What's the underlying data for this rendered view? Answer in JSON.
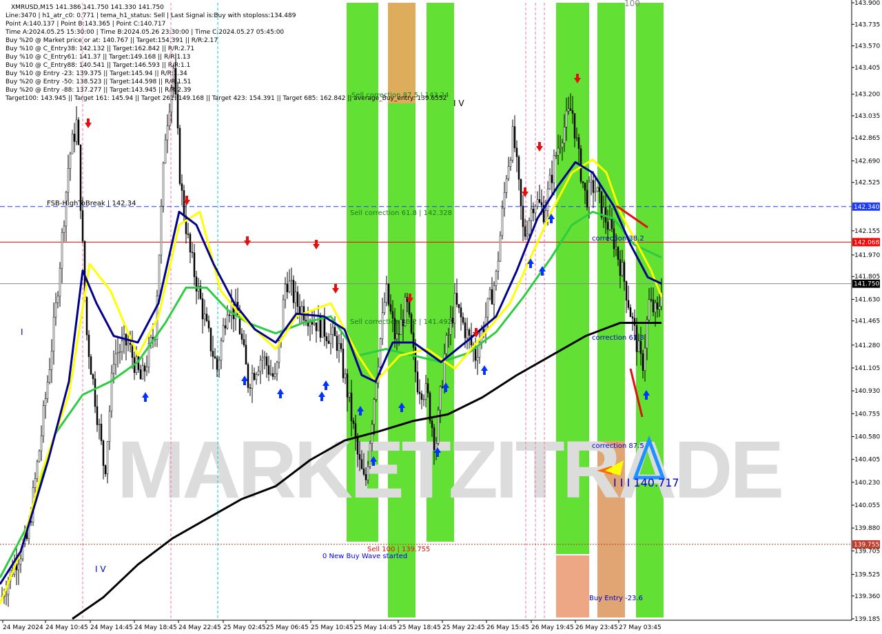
{
  "chart_data": {
    "type": "candlestick",
    "symbol": "XMRUSD,M15",
    "ohlc_header": "141.386 141.750 141.330 141.750",
    "info_lines": [
      "XMRUSD,M15  141.386 141.750 141.330 141.750",
      "Line:3470 | h1_atr_c0: 0.771 | tema_h1_status: Sell | Last Signal is:Buy with stoploss:134.489",
      "Point A:140.137 | Point B:143.365 | Point C:140.717",
      "Time A:2024.05.25 15:30:00 | Time B:2024.05.26 23:30:00 | Time C:2024.05.27 05:45:00",
      "Buy %20 @ Market price or at: 140.767 || Target:154.391 || R/R:2.17",
      "Buy %10 @ C_Entry38: 142.132 || Target:162.842 || R/R:2.71",
      "Buy %10 @ C_Entry61: 141.37 || Target:149.168 || R/R:1.13",
      "Buy %10 @ C_Entry88: 140.541 || Target:146.593 || R/R:1.1",
      "Buy %10 @ Entry -23: 139.375 || Target:145.94 || R/R:1.34",
      "Buy %20 @ Entry -50: 138.523 || Target:144.598 || R/R:1.51",
      "Buy %20 @ Entry -88: 137.277 || Target:143.945 || R/R:2.39",
      "Target100: 143.945 || Target 161: 145.94 || Target 261: 149.168 || Target 423: 154.391 || Target 685: 162.842 || average_Buy_entry: 139.6552"
    ],
    "y_range": [
      139.185,
      143.9
    ],
    "y_ticks": [
      "143.900",
      "143.735",
      "143.570",
      "143.405",
      "143.200",
      "143.035",
      "142.865",
      "142.690",
      "142.525",
      "142.340",
      "142.155",
      "141.970",
      "141.805",
      "141.630",
      "141.465",
      "141.280",
      "141.105",
      "140.930",
      "140.755",
      "140.580",
      "140.405",
      "140.230",
      "140.055",
      "139.880",
      "139.705",
      "139.525",
      "139.360",
      "139.185"
    ],
    "x_ticks": [
      "24 May 2024",
      "24 May 10:45",
      "24 May 14:45",
      "24 May 18:45",
      "24 May 22:45",
      "25 May 02:45",
      "25 May 06:45",
      "25 May 10:45",
      "25 May 14:45",
      "25 May 18:45",
      "25 May 22:45",
      "26 May 15:45",
      "26 May 19:45",
      "26 May 23:45",
      "27 May 03:45"
    ],
    "price_labels": [
      {
        "value": 142.34,
        "text": "142.340",
        "color": "#1e3cff"
      },
      {
        "value": 142.068,
        "text": "142.068",
        "color": "#ff0000"
      },
      {
        "value": 141.75,
        "text": "141.750",
        "color": "#000000"
      },
      {
        "value": 139.755,
        "text": "139.755",
        "color": "#c0392b"
      }
    ],
    "annotations": [
      {
        "text": "Sell correction 87.5 | 143.24",
        "color": "#1a7a1a"
      },
      {
        "text": "Sell correction 61.8 | 142.328",
        "color": "#1a7a1a"
      },
      {
        "text": "Sell correction 38.2 | 141.492",
        "color": "#1a7a1a"
      },
      {
        "text": "FSB-HighToBreak | 142.34",
        "color": "#000000"
      },
      {
        "text": "Sell 100 | 139.755",
        "color": "#e01010"
      },
      {
        "text": "0 New Buy Wave started",
        "color": "#0000ff"
      },
      {
        "text": "correction 38.2",
        "color": "#0000cc"
      },
      {
        "text": "correction 61.8",
        "color": "#0000cc"
      },
      {
        "text": "correction 87.5",
        "color": "#0000cc"
      },
      {
        "text": "Buy Entry -23.6",
        "color": "#0000cc"
      },
      {
        "text": "I I I 140.717",
        "color": "#0000cc"
      },
      {
        "text": "I V",
        "color": "#000000"
      },
      {
        "text": "I V",
        "color": "#0000cc"
      },
      {
        "text": "I",
        "color": "#0000cc"
      },
      {
        "text": "100",
        "color": "#888888"
      }
    ],
    "watermark": "MARKETZITRADE",
    "series": [
      {
        "name": "",
        "color": "#00008b",
        "kind": "fast-ma"
      },
      {
        "name": "",
        "color": "#ffff00",
        "kind": "ma"
      },
      {
        "name": "",
        "color": "#2ecc40",
        "kind": "ma"
      },
      {
        "name": "",
        "color": "#000000",
        "kind": "slow-ma"
      }
    ],
    "grid": false
  }
}
